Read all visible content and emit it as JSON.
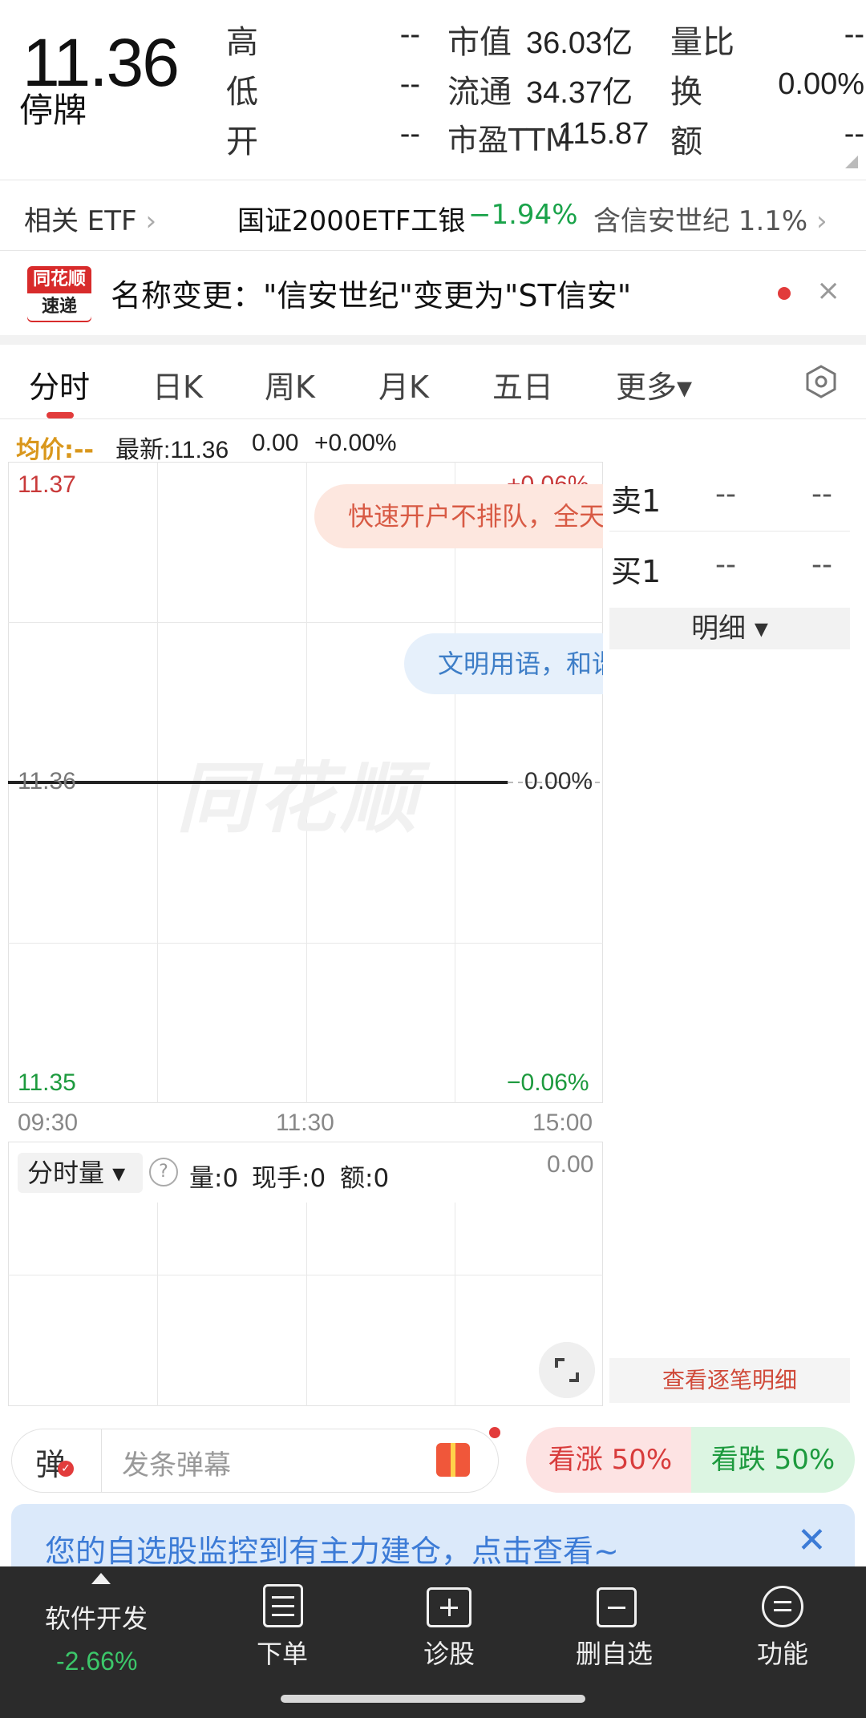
{
  "quote": {
    "price": "11.36",
    "status": "停牌",
    "rows": [
      {
        "l1": "高",
        "v1": "--",
        "l2": "市值",
        "v2": "36.03亿",
        "l3": "量比",
        "v3": "--"
      },
      {
        "l1": "低",
        "v1": "--",
        "l2": "流通",
        "v2": "34.37亿",
        "l3": "换",
        "v3": "0.00%"
      },
      {
        "l1": "开",
        "v1": "--",
        "l2": "市盈TTM",
        "v2": "115.87",
        "l3": "额",
        "v3": "--"
      }
    ]
  },
  "etf": {
    "label": "相关 ETF",
    "name": "国证2000ETF工银",
    "change": "−1.94%",
    "holding": "含信安世纪  1.1%"
  },
  "news": {
    "logo_top": "同花顺",
    "logo_bottom": "速递",
    "text": "名称变更：\"信安世纪\"变更为\"ST信安\"",
    "close": "×"
  },
  "tabs": [
    {
      "label": "分时",
      "active": true
    },
    {
      "label": "日K"
    },
    {
      "label": "周K"
    },
    {
      "label": "月K"
    },
    {
      "label": "五日"
    },
    {
      "label": "更多▾"
    }
  ],
  "info": {
    "avg": "均价:--",
    "latest": "最新:11.36",
    "change": "0.00",
    "pct": "+0.00%"
  },
  "chart_data": {
    "type": "line",
    "x_ticks": [
      "09:30",
      "11:30",
      "15:00"
    ],
    "y_left": {
      "max": "11.37",
      "mid": "11.36",
      "min": "11.35"
    },
    "y_right": {
      "max": "+0.06%",
      "mid": "0.00%",
      "min": "−0.06%"
    },
    "ylim": [
      11.35,
      11.37
    ],
    "series": [
      {
        "x": [
          0,
          0.84
        ],
        "values": [
          11.36,
          11.36
        ]
      }
    ],
    "watermark": "同花顺"
  },
  "bubbles": {
    "b1": "快速开户不排队，全天",
    "b2": "文明用语，和谐"
  },
  "volume": {
    "select": "分时量 ▾",
    "help": "?",
    "vol": "量:0",
    "now": "现手:0",
    "amount": "额:0",
    "right_top": "0.00"
  },
  "orderbook": {
    "sell1": {
      "label": "卖1",
      "price": "--",
      "qty": "--"
    },
    "buy1": {
      "label": "买1",
      "price": "--",
      "qty": "--"
    },
    "detail": "明细 ▾",
    "tick_detail": "查看逐笔明细"
  },
  "comment": {
    "dan": "弹",
    "placeholder": "发条弹幕",
    "up": "看涨 50%",
    "down": "看跌 50%",
    "up_ratio": 0.5
  },
  "notice": {
    "text": "您的自选股监控到有主力建仓，点击查看~",
    "close": "✕"
  },
  "nav": {
    "sector": "软件开发",
    "sector_pct": "-2.66%",
    "items": [
      "下单",
      "诊股",
      "删自选",
      "功能"
    ]
  },
  "colors": {
    "up_red": "#d83c3c",
    "down_green": "#1d9a3e",
    "accent_blue": "#3c7bd6"
  }
}
